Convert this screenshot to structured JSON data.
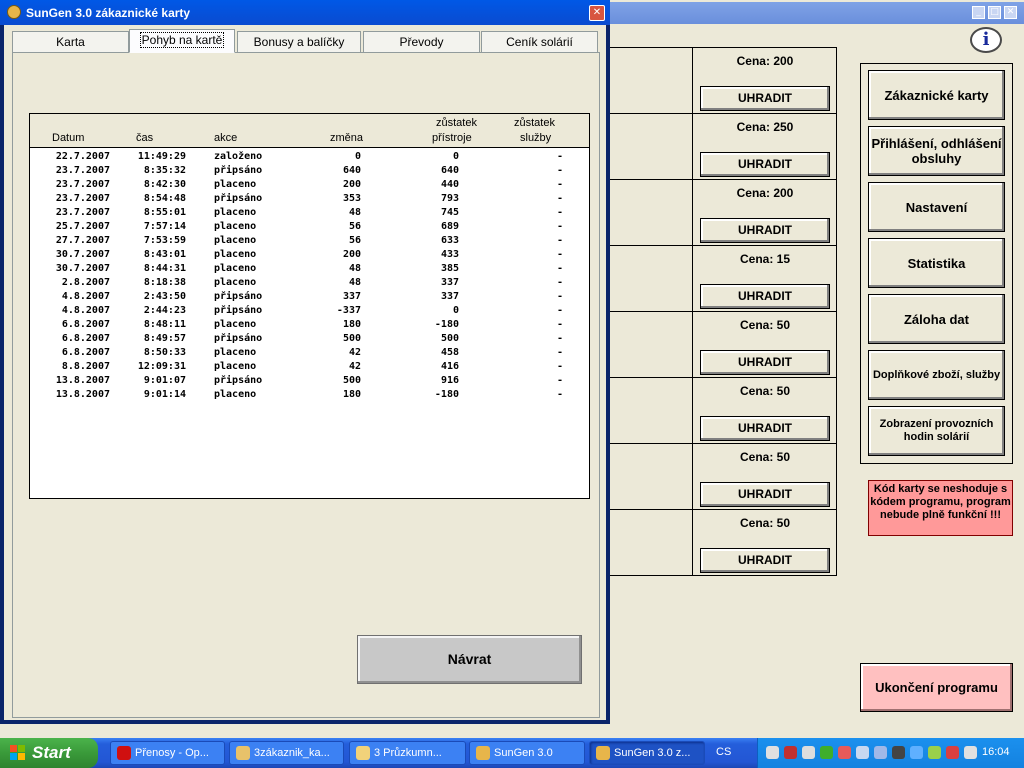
{
  "dialog": {
    "title": "SunGen 3.0 zákaznické karty",
    "tabs": [
      {
        "label": "Karta"
      },
      {
        "label": "Pohyb na kartě"
      },
      {
        "label": "Bonusy a balíčky"
      },
      {
        "label": "Převody"
      },
      {
        "label": "Ceník solárií"
      }
    ],
    "active_tab": "Pohyb na kartě",
    "table": {
      "headers": {
        "date": "Datum",
        "time": "čas",
        "action": "akce",
        "change": "změna",
        "device_balance_1": "zůstatek",
        "device_balance_2": "přístroje",
        "service_balance_1": "zůstatek",
        "service_balance_2": "služby"
      },
      "rows": [
        {
          "date": "22.7.2007",
          "time": "11:49:29",
          "action": "založeno",
          "change": "0",
          "device": "0",
          "service": "-"
        },
        {
          "date": "23.7.2007",
          "time": "8:35:32",
          "action": "připsáno",
          "change": "640",
          "device": "640",
          "service": "-"
        },
        {
          "date": "23.7.2007",
          "time": "8:42:30",
          "action": "placeno",
          "change": "200",
          "device": "440",
          "service": "-"
        },
        {
          "date": "23.7.2007",
          "time": "8:54:48",
          "action": "připsáno",
          "change": "353",
          "device": "793",
          "service": "-"
        },
        {
          "date": "23.7.2007",
          "time": "8:55:01",
          "action": "placeno",
          "change": "48",
          "device": "745",
          "service": "-"
        },
        {
          "date": "25.7.2007",
          "time": "7:57:14",
          "action": "placeno",
          "change": "56",
          "device": "689",
          "service": "-"
        },
        {
          "date": "27.7.2007",
          "time": "7:53:59",
          "action": "placeno",
          "change": "56",
          "device": "633",
          "service": "-"
        },
        {
          "date": "30.7.2007",
          "time": "8:43:01",
          "action": "placeno",
          "change": "200",
          "device": "433",
          "service": "-"
        },
        {
          "date": "30.7.2007",
          "time": "8:44:31",
          "action": "placeno",
          "change": "48",
          "device": "385",
          "service": "-"
        },
        {
          "date": "2.8.2007",
          "time": "8:18:38",
          "action": "placeno",
          "change": "48",
          "device": "337",
          "service": "-"
        },
        {
          "date": "4.8.2007",
          "time": "2:43:50",
          "action": "připsáno",
          "change": "337",
          "device": "337",
          "service": "-"
        },
        {
          "date": "4.8.2007",
          "time": "2:44:23",
          "action": "připsáno",
          "change": "-337",
          "device": "0",
          "service": "-"
        },
        {
          "date": "6.8.2007",
          "time": "8:48:11",
          "action": "placeno",
          "change": "180",
          "device": "-180",
          "service": "-"
        },
        {
          "date": "6.8.2007",
          "time": "8:49:57",
          "action": "připsáno",
          "change": "500",
          "device": "500",
          "service": "-"
        },
        {
          "date": "6.8.2007",
          "time": "8:50:33",
          "action": "placeno",
          "change": "42",
          "device": "458",
          "service": "-"
        },
        {
          "date": "8.8.2007",
          "time": "12:09:31",
          "action": "placeno",
          "change": "42",
          "device": "416",
          "service": "-"
        },
        {
          "date": "13.8.2007",
          "time": "9:01:07",
          "action": "připsáno",
          "change": "500",
          "device": "916",
          "service": "-"
        },
        {
          "date": "13.8.2007",
          "time": "9:01:14",
          "action": "placeno",
          "change": "180",
          "device": "-180",
          "service": "-"
        }
      ]
    },
    "back_label": "Návrat"
  },
  "prices": [
    {
      "label": "Cena: 200",
      "button": "UHRADIT"
    },
    {
      "label": "Cena: 250",
      "button": "UHRADIT"
    },
    {
      "label": "Cena: 200",
      "button": "UHRADIT"
    },
    {
      "label": "Cena: 15",
      "button": "UHRADIT"
    },
    {
      "label": "Cena: 50",
      "button": "UHRADIT"
    },
    {
      "label": "Cena: 50",
      "button": "UHRADIT"
    },
    {
      "label": "Cena: 50",
      "button": "UHRADIT"
    },
    {
      "label": "Cena: 50",
      "button": "UHRADIT"
    }
  ],
  "menu": [
    {
      "label": "Zákaznické karty",
      "size": "big"
    },
    {
      "label": "Přihlášení, odhlášení obsluhy",
      "size": "big"
    },
    {
      "label": "Nastavení",
      "size": "big"
    },
    {
      "label": "Statistika",
      "size": "big"
    },
    {
      "label": "Záloha dat",
      "size": "big"
    },
    {
      "label": "Doplňkové zboží, služby",
      "size": "small"
    },
    {
      "label": "Zobrazení provozních hodin solárií",
      "size": "small"
    }
  ],
  "warning": "Kód karty se neshoduje s kódem programu, program nebude plně funkční !!!",
  "exit_label": "Ukončení programu",
  "info_icon": "i",
  "taskbar": {
    "start": "Start",
    "tasks": [
      {
        "label": "Přenosy - Op...",
        "icon": "opera-icon",
        "color": "#d01010",
        "active": false
      },
      {
        "label": "3zákaznik_ka...",
        "icon": "paint-icon",
        "color": "#e8c26a",
        "active": false
      },
      {
        "label": "3 Průzkumn...",
        "icon": "folder-icon",
        "color": "#f1d27a",
        "active": false
      },
      {
        "label": "SunGen 3.0",
        "icon": "sungen-icon",
        "color": "#e7b54a",
        "active": false
      },
      {
        "label": "SunGen 3.0 z...",
        "icon": "sungen-icon",
        "color": "#e7b54a",
        "active": true
      }
    ],
    "language": "CS",
    "clock": "16:04"
  }
}
